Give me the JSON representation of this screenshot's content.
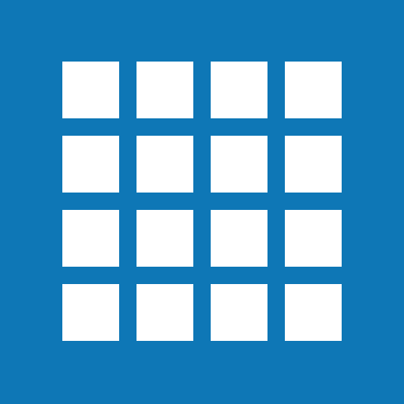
{
  "icon": {
    "name": "grid-app-icon",
    "background_color": "#0e77b6",
    "tile_color": "#ffffff",
    "rows": 4,
    "columns": 4
  }
}
